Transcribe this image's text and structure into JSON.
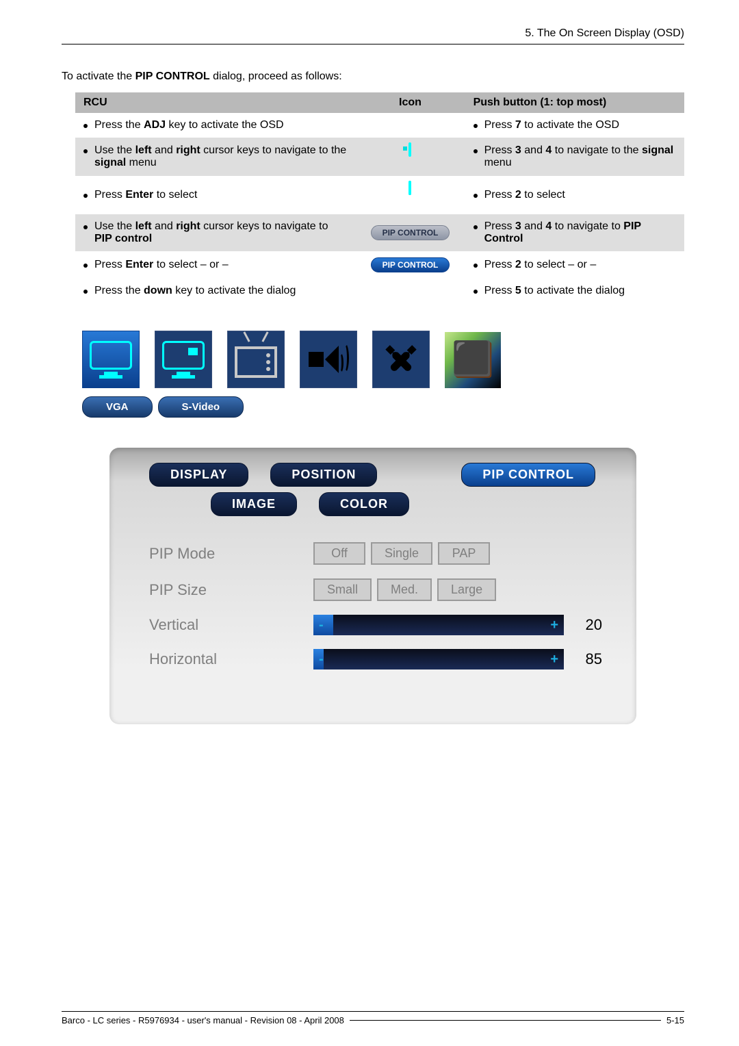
{
  "header": {
    "breadcrumb": "5. The On Screen Display (OSD)"
  },
  "intro": {
    "prefix": "To activate the ",
    "bold": "PIP CONTROL",
    "suffix": " dialog, proceed as follows:"
  },
  "table": {
    "headers": {
      "rcu": "RCU",
      "icon": "Icon",
      "push": "Push button (1: top most)"
    },
    "rows": [
      {
        "rcu": {
          "pre": "Press the ",
          "b": "ADJ",
          "post": " key to activate the OSD"
        },
        "push": {
          "pre": "Press ",
          "b": "7",
          "post": " to activate the OSD"
        },
        "icon": ""
      },
      {
        "rcu": {
          "pre": "Use the ",
          "b1": "left",
          "mid1": " and ",
          "b2": "right",
          "mid2": " cursor keys to navigate to the ",
          "b3": "signal",
          "post": " menu"
        },
        "push": {
          "pre": "Press ",
          "b1": "3",
          "mid": " and ",
          "b2": "4",
          "mid2": " to navigate to the ",
          "b3": "signal",
          "post": " menu"
        },
        "icon": "monitor-sub"
      },
      {
        "rcu": {
          "pre": "Press ",
          "b": "Enter",
          "post": " to select"
        },
        "push": {
          "pre": "Press ",
          "b": "2",
          "post": " to select"
        },
        "icon": "monitor"
      },
      {
        "rcu": {
          "pre": "Use the ",
          "b1": "left",
          "mid1": " and ",
          "b2": "right",
          "mid2": " cursor keys to navigate to ",
          "b3": "PIP control",
          "post": ""
        },
        "push": {
          "pre": "Press ",
          "b1": "3",
          "mid": " and ",
          "b2": "4",
          "mid2": " to navigate to ",
          "b3": "PIP Control",
          "post": ""
        },
        "icon": "pip-inactive"
      },
      {
        "rcu": {
          "pre": "Press ",
          "b": "Enter",
          "post": " to select – or –"
        },
        "push": {
          "pre": "Press ",
          "b": "2",
          "post": " to select – or –"
        },
        "icon": "pip-active"
      },
      {
        "rcu": {
          "pre": "Press the ",
          "b": "down",
          "post": " key to activate the dialog"
        },
        "push": {
          "pre": "Press ",
          "b": "5",
          "post": " to activate the dialog"
        },
        "icon": ""
      }
    ],
    "pip_label": "PIP CONTROL"
  },
  "source_tabs": {
    "vga": "VGA",
    "svideo": "S-Video"
  },
  "panel": {
    "tabs": {
      "display": "DISPLAY",
      "position": "POSITION",
      "pip": "PIP CONTROL",
      "image": "IMAGE",
      "color": "COLOR"
    },
    "rows": {
      "mode": {
        "label": "PIP Mode",
        "opts": [
          "Off",
          "Single",
          "PAP"
        ]
      },
      "size": {
        "label": "PIP Size",
        "opts": [
          "Small",
          "Med.",
          "Large"
        ]
      },
      "vertical": {
        "label": "Vertical",
        "value": "20",
        "fill_pct": 8
      },
      "horizontal": {
        "label": "Horizontal",
        "value": "85",
        "fill_pct": 4
      }
    }
  },
  "footer": {
    "left": "Barco - LC series - R5976934 - user's manual - Revision 08 - April 2008",
    "right": "5-15"
  }
}
